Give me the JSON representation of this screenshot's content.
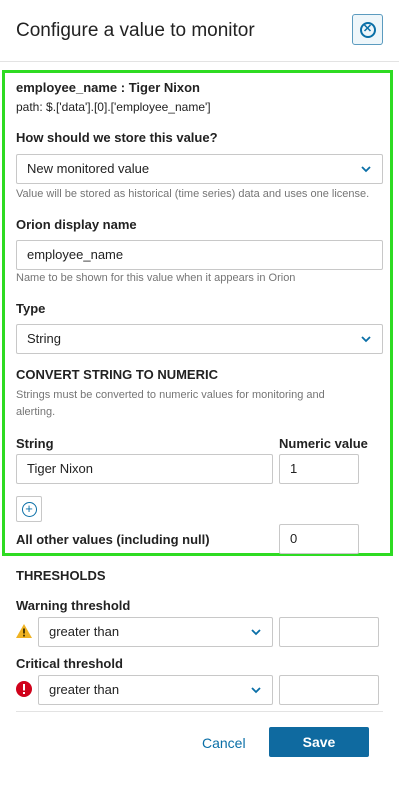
{
  "header": {
    "title": "Configure a value to monitor"
  },
  "property": {
    "name_label": "employee_name : Tiger Nixon",
    "path": "path: $.['data'].[0].['employee_name']"
  },
  "storage": {
    "label": "How should we store this value?",
    "selected": "New monitored value",
    "help": "Value will be stored as historical (time series) data and uses one license."
  },
  "display_name": {
    "label": "Orion display name",
    "value": "employee_name",
    "help": "Name to be shown for this value when it appears in Orion"
  },
  "type": {
    "label": "Type",
    "selected": "String"
  },
  "convert": {
    "heading": "CONVERT STRING TO NUMERIC",
    "help": "Strings must be converted to numeric values for monitoring and alerting.",
    "string_header": "String",
    "numeric_header": "Numeric value",
    "rows": [
      {
        "string": "Tiger Nixon",
        "numeric": "1"
      }
    ],
    "other_label": "All other values (including null)",
    "other_value": "0"
  },
  "thresholds": {
    "heading": "THRESHOLDS",
    "warning": {
      "label": "Warning threshold",
      "operator": "greater than",
      "value": ""
    },
    "critical": {
      "label": "Critical threshold",
      "operator": "greater than",
      "value": ""
    }
  },
  "footer": {
    "cancel_label": "Cancel",
    "save_label": "Save"
  },
  "colors": {
    "accent": "#0a6fa7",
    "save_bg": "#0f6aa0",
    "highlight": "#2edb22",
    "warning": "#f0b323",
    "critical": "#d0021b"
  }
}
